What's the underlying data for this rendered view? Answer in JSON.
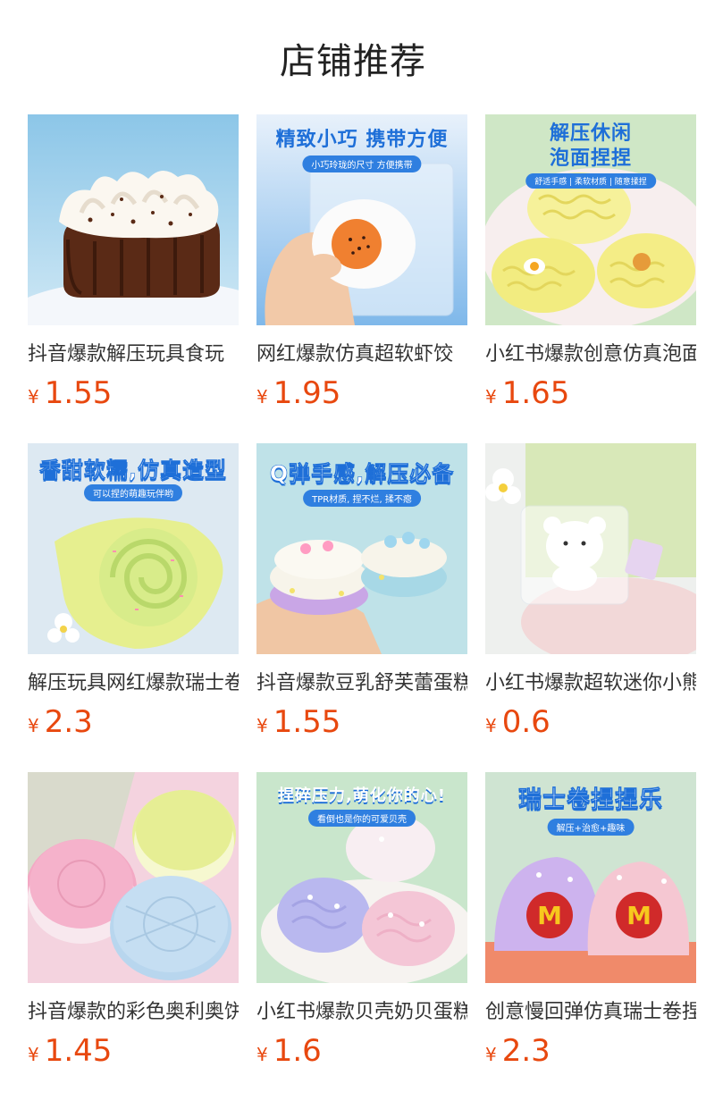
{
  "page": {
    "title": "店铺推荐"
  },
  "products": [
    {
      "name": "抖音爆款解压玩具食玩",
      "currency": "¥",
      "price": "1.55",
      "banner": "",
      "sub": "",
      "icon": "chocolate-cake-squishy-image"
    },
    {
      "name": "网红爆款仿真超软虾饺",
      "currency": "¥",
      "price": "1.95",
      "banner": "精致小巧 携带方便",
      "sub": "小巧玲珑的尺寸 方便携带",
      "icon": "dumpling-squishy-image"
    },
    {
      "name": "小红书爆款创意仿真泡面",
      "currency": "¥",
      "price": "1.65",
      "banner": "解压休闲\n泡面捏捏",
      "sub": "舒适手感 | 柔软材质 | 随意揉捏",
      "icon": "noodle-squishy-image"
    },
    {
      "name": "解压玩具网红爆款瑞士卷",
      "currency": "¥",
      "price": "2.3",
      "banner": "香甜软糯,仿真造型",
      "sub": "可以捏的萌趣玩伴哟",
      "icon": "swiss-roll-squishy-image"
    },
    {
      "name": "抖音爆款豆乳舒芙蕾蛋糕",
      "currency": "¥",
      "price": "1.55",
      "banner": "Q弹手感,解压必备",
      "sub": "TPR材质, 捏不烂, 揉不瘪",
      "icon": "souffle-squishy-image"
    },
    {
      "name": "小红书爆款超软迷你小熊",
      "currency": "¥",
      "price": "0.6",
      "banner": "",
      "sub": "",
      "icon": "bear-squishy-image"
    },
    {
      "name": "抖音爆款的彩色奥利奥饼干",
      "currency": "¥",
      "price": "1.45",
      "banner": "",
      "sub": "",
      "icon": "oreo-squishy-image"
    },
    {
      "name": "小红书爆款贝壳奶贝蛋糕",
      "currency": "¥",
      "price": "1.6",
      "banner": "捏碎压力,萌化你的心!",
      "sub": "看倒也是你的可爱贝壳",
      "icon": "shell-cake-squishy-image"
    },
    {
      "name": "创意慢回弹仿真瑞士卷捏捏",
      "currency": "¥",
      "price": "2.3",
      "banner": "瑞士卷捏捏乐",
      "sub": "解压+治愈+趣味",
      "icon": "mcdonalds-roll-squishy-image"
    }
  ]
}
